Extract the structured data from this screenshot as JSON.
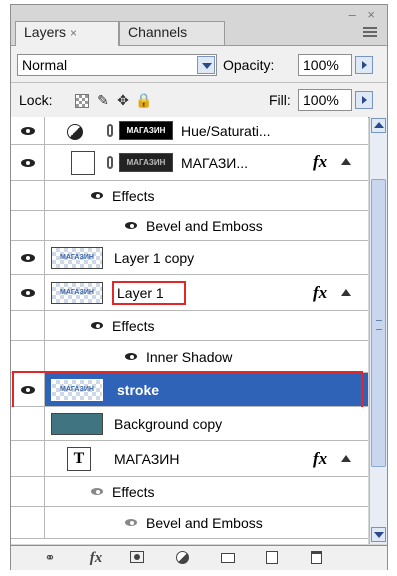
{
  "panel": {
    "tabs": [
      {
        "label": "Layers",
        "close": "×"
      },
      {
        "label": "Channels"
      }
    ],
    "window_controls": "– ×"
  },
  "controls": {
    "blend_mode": "Normal",
    "opacity_label": "Opacity:",
    "opacity_value": "100%",
    "lock_label": "Lock:",
    "fill_label": "Fill:",
    "fill_value": "100%"
  },
  "layers": [
    {
      "name": "Hue/Saturati...",
      "type": "adjustment",
      "thumb_text": "МАГАЗИН"
    },
    {
      "name": "МАГАЗИ...",
      "type": "layer",
      "fx": "fx",
      "thumb_text": "МАГАЗИН"
    },
    {
      "name": "Effects",
      "type": "effects-group"
    },
    {
      "name": "Bevel and Emboss",
      "type": "effect"
    },
    {
      "name": "Layer 1 copy",
      "type": "layer",
      "thumb_text": "МАГАЗИН"
    },
    {
      "name": "Layer 1",
      "type": "layer",
      "fx": "fx",
      "thumb_text": "МАГАЗИН"
    },
    {
      "name": "Effects",
      "type": "effects-group"
    },
    {
      "name": "Inner Shadow",
      "type": "effect"
    },
    {
      "name": "stroke",
      "type": "layer",
      "selected": true,
      "thumb_text": "МАГАЗИН"
    },
    {
      "name": "Background copy",
      "type": "layer"
    },
    {
      "name": "МАГАЗИН",
      "type": "text-layer",
      "fx": "fx",
      "thumb_text": "T"
    },
    {
      "name": "Effects",
      "type": "effects-group"
    },
    {
      "name": "Bevel and Emboss",
      "type": "effect"
    }
  ],
  "bottom_bar": {
    "icons": [
      "link-icon",
      "fx-icon",
      "mask-icon",
      "adjustment-icon",
      "folder-icon",
      "new-layer-icon",
      "trash-icon"
    ],
    "fx_label": "fx"
  },
  "colors": {
    "selected_row": "#2f63b8",
    "highlight_box": "#e0282a",
    "background_copy_thumb": "#3f7480"
  }
}
